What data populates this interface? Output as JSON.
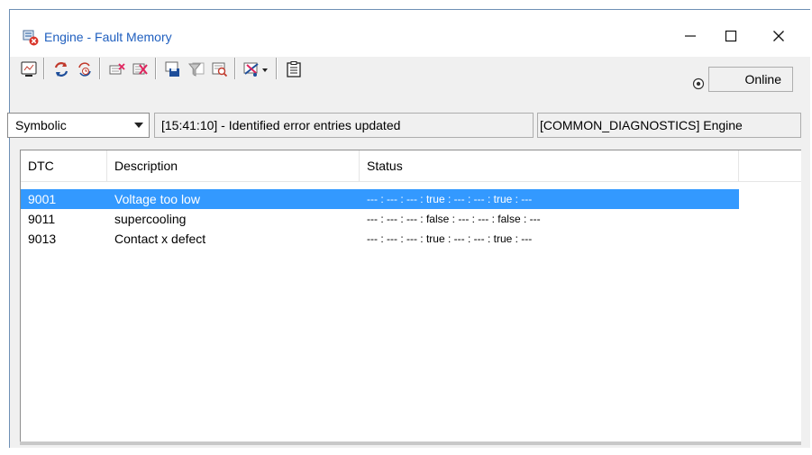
{
  "window": {
    "title": "Engine - Fault Memory",
    "controls": {
      "minimize": "—",
      "maximize": "☐",
      "close": "✕"
    }
  },
  "toolbar": {
    "icons": [
      "monitor-icon",
      "refresh-icon",
      "refresh-auto-icon",
      "clear-entry-icon",
      "delete-entries-icon",
      "save-icon",
      "filter-icon",
      "inspect-icon",
      "tools-dropdown-icon",
      "clipboard-icon"
    ],
    "online_label": "Online"
  },
  "filter": {
    "mode": "Symbolic",
    "message": "[15:41:10] - Identified error entries updated",
    "ecu": "[COMMON_DIAGNOSTICS] Engine"
  },
  "table": {
    "columns": [
      "DTC",
      "Description",
      "Status"
    ],
    "rows": [
      {
        "dtc": "9001",
        "description": "Voltage too low",
        "status": "--- : --- : --- : true : --- : --- : true : ---",
        "selected": true
      },
      {
        "dtc": "9011",
        "description": "supercooling",
        "status": "--- : --- : --- : false : --- : --- : false : ---",
        "selected": false
      },
      {
        "dtc": "9013",
        "description": "Contact x defect",
        "status": "--- : --- : --- : true : --- : --- : true : ---",
        "selected": false
      }
    ]
  },
  "colors": {
    "selection": "#3399ff",
    "title_text": "#1f5fbf",
    "window_bg": "#f0f0f0"
  }
}
